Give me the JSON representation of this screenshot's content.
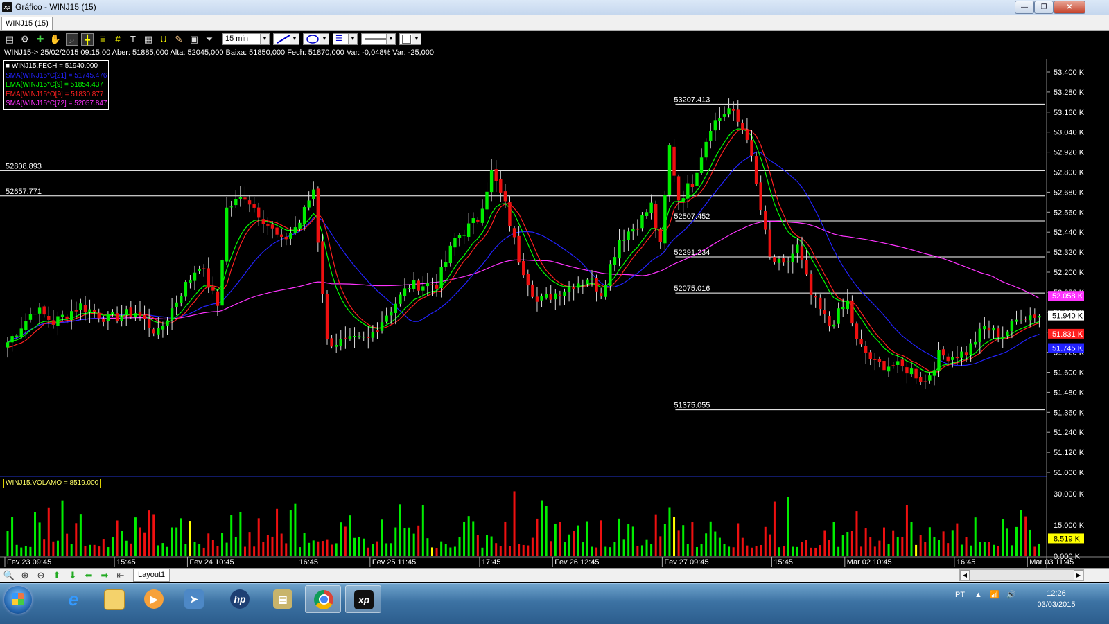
{
  "window": {
    "title": "Gráfico - WINJ15 (15)",
    "logo_text": "xp",
    "min_label": "—",
    "max_label": "❐",
    "close_label": "✕"
  },
  "tab": {
    "label": "WINJ15 (15)"
  },
  "toolbar": {
    "interval": "15 min",
    "icons": [
      "chart-type-icon",
      "settings-gear-icon",
      "crosshair-icon",
      "hand-pan-icon",
      "zoom-icon",
      "cursor-cross-icon",
      "horizontal-line-icon",
      "grid-icon",
      "text-tool-icon",
      "calculator-icon",
      "magnet-icon",
      "brush-icon",
      "clipboard-icon",
      "filter-icon"
    ]
  },
  "info_line": "WINJ15-> 25/02/2015 09:15:00 Aber: 51885,000 Alta: 52045,000 Baixa: 51850,000 Fech: 51870,000 Var: -0,048% Var: -25,000",
  "legend": [
    {
      "text": "■ WINJ15.FECH = 51940.000",
      "color": "#ffffff"
    },
    {
      "text": "SMA[WINJ15*C[21] = 51745.476",
      "color": "#2222ff"
    },
    {
      "text": "EMA[WINJ15*C[9] = 51854.437",
      "color": "#00ff00"
    },
    {
      "text": "EMA[WINJ15*O[9] = 51830.877",
      "color": "#ff2020"
    },
    {
      "text": "SMA[WINJ15*C[72] = 52057.847",
      "color": "#ff33ff"
    }
  ],
  "volume_legend": "WINJ15.VOLAMO = 8519.000",
  "chart_data": {
    "type": "candlestick",
    "price_axis": {
      "min": 51000,
      "max": 53400,
      "ticks": [
        53400,
        53280,
        53160,
        53040,
        52920,
        52800,
        52680,
        52560,
        52440,
        52320,
        52200,
        52080,
        51960,
        51840,
        51720,
        51600,
        51480,
        51360,
        51240,
        51120,
        51000
      ],
      "tick_labels": [
        "53.400 K",
        "53.280 K",
        "53.160 K",
        "53.040 K",
        "52.920 K",
        "52.800 K",
        "52.680 K",
        "52.560 K",
        "52.440 K",
        "52.320 K",
        "52.200 K",
        "52.080 K",
        "51.960 K",
        "51.840 K",
        "51.720 K",
        "51.600 K",
        "51.480 K",
        "51.360 K",
        "51.240 K",
        "51.120 K",
        "51.000 K"
      ]
    },
    "price_badges": [
      {
        "label": "52.058 K",
        "value": 52058,
        "color": "#ff33ff"
      },
      {
        "label": "51.940 K",
        "value": 51940,
        "color": "#ffffff"
      },
      {
        "label": "51.831 K",
        "value": 51831,
        "color": "#ff2020"
      },
      {
        "label": "51.745 K",
        "value": 51745,
        "color": "#2222ff"
      }
    ],
    "volume_axis": {
      "min": 0,
      "max": 38000,
      "tick_labels": [
        "30.000 K",
        "15.000 K",
        "0.000 K"
      ],
      "ticks": [
        30000,
        15000,
        0
      ],
      "badge": {
        "label": "8.519 K",
        "value": 8519
      }
    },
    "horizontal_lines": [
      {
        "value": 53207.413,
        "label": "53207.413",
        "x_from": 0.645
      },
      {
        "value": 52808.893,
        "label": "52808.893",
        "x_from": 0
      },
      {
        "value": 52657.771,
        "label": "52657.771",
        "x_from": 0
      },
      {
        "value": 52507.452,
        "label": "52507.452",
        "x_from": 0.645
      },
      {
        "value": 52291.234,
        "label": "52291.234",
        "x_from": 0.645
      },
      {
        "value": 52075.016,
        "label": "52075.016",
        "x_from": 0.645
      },
      {
        "value": 51375.055,
        "label": "51375.055",
        "x_from": 0.645
      }
    ],
    "time_labels": [
      {
        "label": "Fev 23 09:45",
        "index": 0
      },
      {
        "label": "15:45",
        "index": 24
      },
      {
        "label": "Fev 24 10:45",
        "index": 40
      },
      {
        "label": "16:45",
        "index": 64
      },
      {
        "label": "Fev 25 11:45",
        "index": 80
      },
      {
        "label": "17:45",
        "index": 104
      },
      {
        "label": "Fev 26 12:45",
        "index": 120
      },
      {
        "label": "Fev 27 09:45",
        "index": 144
      },
      {
        "label": "15:45",
        "index": 168
      },
      {
        "label": "Mar 02 10:45",
        "index": 184
      },
      {
        "label": "16:45",
        "index": 208
      },
      {
        "label": "Mar 03 11:45",
        "index": 224
      }
    ],
    "close_anchors": [
      [
        0,
        51780
      ],
      [
        6,
        51980
      ],
      [
        10,
        51900
      ],
      [
        16,
        52000
      ],
      [
        22,
        51920
      ],
      [
        28,
        51960
      ],
      [
        33,
        51830
      ],
      [
        38,
        52080
      ],
      [
        42,
        52250
      ],
      [
        46,
        52000
      ],
      [
        48,
        52580
      ],
      [
        52,
        52660
      ],
      [
        56,
        52520
      ],
      [
        60,
        52380
      ],
      [
        64,
        52500
      ],
      [
        67,
        52700
      ],
      [
        70,
        51780
      ],
      [
        74,
        51780
      ],
      [
        79,
        51800
      ],
      [
        83,
        51950
      ],
      [
        88,
        52120
      ],
      [
        94,
        52130
      ],
      [
        98,
        52400
      ],
      [
        103,
        52520
      ],
      [
        106,
        52800
      ],
      [
        109,
        52600
      ],
      [
        112,
        52280
      ],
      [
        116,
        52020
      ],
      [
        122,
        52100
      ],
      [
        127,
        52170
      ],
      [
        130,
        52080
      ],
      [
        134,
        52400
      ],
      [
        138,
        52490
      ],
      [
        141,
        52600
      ],
      [
        143,
        52350
      ],
      [
        145,
        52950
      ],
      [
        147,
        52640
      ],
      [
        150,
        52740
      ],
      [
        154,
        53080
      ],
      [
        158,
        53180
      ],
      [
        162,
        53020
      ],
      [
        164,
        52720
      ],
      [
        167,
        52280
      ],
      [
        170,
        52230
      ],
      [
        173,
        52350
      ],
      [
        176,
        52060
      ],
      [
        180,
        51880
      ],
      [
        184,
        52020
      ],
      [
        186,
        51780
      ],
      [
        190,
        51650
      ],
      [
        194,
        51640
      ],
      [
        198,
        51610
      ],
      [
        201,
        51540
      ],
      [
        204,
        51700
      ],
      [
        207,
        51700
      ],
      [
        210,
        51720
      ],
      [
        214,
        51870
      ],
      [
        218,
        51820
      ],
      [
        222,
        51940
      ],
      [
        226,
        51945
      ]
    ],
    "bar_count": 227
  },
  "navbar": {
    "layout_tab": "Layout1",
    "icons": [
      "zoom-glass-icon",
      "zoom-in-icon",
      "zoom-out-icon",
      "arrow-up-icon",
      "arrow-down-icon",
      "arrow-left-icon",
      "arrow-right-icon",
      "arrow-left-end-icon"
    ]
  },
  "taskbar": {
    "apps": [
      "internet-explorer",
      "file-explorer",
      "media-player",
      "network-app",
      "hp-app",
      "archive-app",
      "chrome",
      "xp-investimentos"
    ],
    "language": "PT",
    "time": "12:26",
    "date": "03/03/2015"
  },
  "colors": {
    "up_candle": "#00ee00",
    "down_candle": "#ee1010",
    "background": "#000000",
    "grid_line": "#ffffff"
  }
}
